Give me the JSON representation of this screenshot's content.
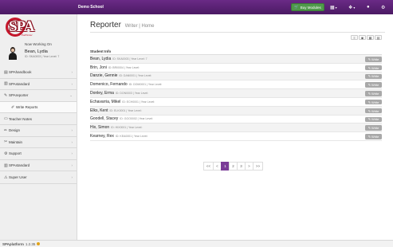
{
  "header": {
    "school": "Demo School",
    "buy_modules": "Buy Modules",
    "icons": [
      "grid-icon",
      "puzzle-icon",
      "user-icon",
      "gear-icon"
    ]
  },
  "sidebar": {
    "logo_text": "SPA",
    "logo_sub": "Pathfinder",
    "working_on": "Now Working On",
    "student_name": "Bean, Lydia",
    "student_id": "ID: SKA0003 | Year Level: 7",
    "items": [
      {
        "label": "SPAhandbook",
        "icon": "book-icon"
      },
      {
        "label": "SPAstandard",
        "icon": "chart-icon"
      },
      {
        "label": "SPAreporter",
        "icon": "wrench-icon"
      },
      {
        "label": "Write Reports",
        "icon": "edit-icon"
      },
      {
        "label": "Teacher Notes",
        "icon": "note-icon"
      },
      {
        "label": "Design",
        "icon": "pencil-icon"
      },
      {
        "label": "Maintain",
        "icon": "wrench-icon"
      },
      {
        "label": "Support",
        "icon": "gear-icon"
      },
      {
        "label": "SPAstandard",
        "icon": "chart-icon"
      },
      {
        "label": "Super User",
        "icon": "warning-icon"
      }
    ]
  },
  "main": {
    "title": "Reporter",
    "subtitle": "Writer | Home",
    "column_header": "Student Info",
    "write_label": "Write",
    "students": [
      {
        "name": "Bean, Lydia",
        "meta": "ID: SKA0003 | Year Level: 7"
      },
      {
        "name": "Brin, Joni",
        "meta": "ID: BRI0004 | Year Level:"
      },
      {
        "name": "Danzie, Gennie",
        "meta": "ID: DAN0001 | Year Level:"
      },
      {
        "name": "Domenico, Fernando",
        "meta": "ID: DOM0001 | Year Level:"
      },
      {
        "name": "Donley, Erma",
        "meta": "ID: DON0003 | Year Level:"
      },
      {
        "name": "Echavarria, Mikel",
        "meta": "ID: ECH0001 | Year Level:"
      },
      {
        "name": "Elks, Kent",
        "meta": "ID: ELK0001 | Year Level:"
      },
      {
        "name": "Goodell, Stacey",
        "meta": "ID: GOO0002 | Year Level:"
      },
      {
        "name": "Hix, Simon",
        "meta": "ID: HIX0001 | Year Level:"
      },
      {
        "name": "Kearney, Rex",
        "meta": "ID: KEA0001 | Year Level:"
      }
    ],
    "pagination": [
      "<<",
      "<",
      "1",
      "2",
      "3",
      ">",
      ">>"
    ],
    "current_page": "1"
  },
  "footer": {
    "brand": "SPAplatform",
    "version": "1.2.35"
  }
}
